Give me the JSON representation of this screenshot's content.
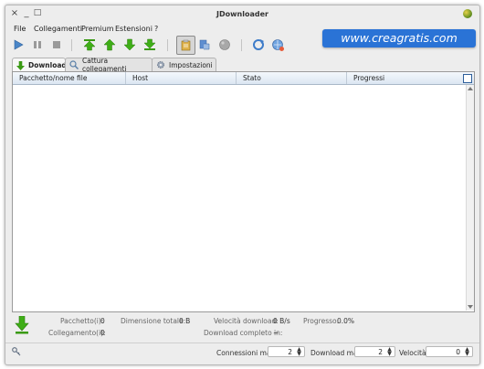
{
  "window": {
    "title": "JDownloader",
    "controls": {
      "close": "×",
      "minimize": "_",
      "maximize": "□"
    }
  },
  "menu": [
    "File",
    "Collegamenti",
    "Premium",
    "Estensioni",
    "?"
  ],
  "watermark": "www.creagratis.com",
  "toolbar_icons": [
    "play-icon",
    "pause-icon",
    "stop-icon",
    "move-top-icon",
    "move-up-icon",
    "move-down-icon",
    "move-bottom-icon",
    "clipboard-icon",
    "reconnect-icon",
    "premium-icon",
    "refresh-icon",
    "update-icon"
  ],
  "tabs": [
    {
      "label": "Download",
      "icon": "download-arrow-icon",
      "active": true
    },
    {
      "label": "Cattura collegamenti",
      "icon": "link-grabber-icon",
      "active": false
    },
    {
      "label": "Impostazioni",
      "icon": "settings-icon",
      "active": false
    }
  ],
  "table": {
    "columns": [
      "Pacchetto/nome file",
      "Host",
      "Stato",
      "Progressi"
    ],
    "rows": []
  },
  "status": {
    "packages_label": "Pacchetto(i):",
    "packages_value": "0",
    "links_label": "Collegamento(i):",
    "links_value": "0",
    "total_size_label": "Dimensione totale:",
    "total_size_value": "0 B",
    "speed_label": "Velocità download:",
    "speed_value": "0 B/s",
    "progress_label": "Progresso:",
    "progress_value": "0.0%",
    "eta_label": "Download completo in:",
    "eta_value": "~"
  },
  "bottom": {
    "connections_label": "Connessioni max",
    "connections_value": "2",
    "max_downloads_label": "Download max",
    "max_downloads_value": "2",
    "speed_label": "Velocità",
    "speed_value": "0"
  },
  "colors": {
    "accent_green": "#3a9a14",
    "accent_blue": "#2a73d6",
    "header_blue": "#dbe6f2"
  }
}
